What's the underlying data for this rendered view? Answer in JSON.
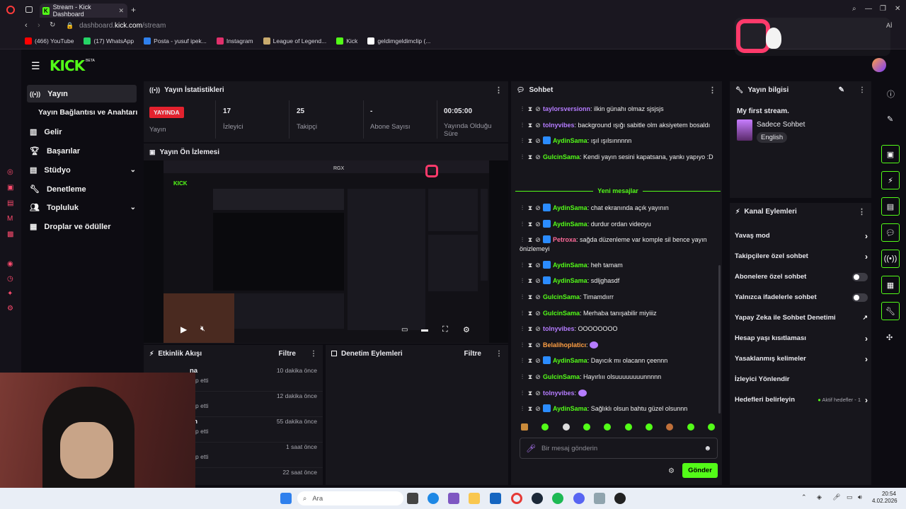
{
  "browser": {
    "tab_title": "Stream - Kick Dashboard",
    "url_prefix": "dashboard.",
    "url_domain": "kick.com",
    "url_path": "/stream",
    "bookmarks": [
      {
        "label": "(466) YouTube",
        "icon": "youtube-icon",
        "color": "#ff0000"
      },
      {
        "label": "(17) WhatsApp",
        "icon": "whatsapp-icon",
        "color": "#25d366"
      },
      {
        "label": "Posta - yusuf ipek...",
        "icon": "mail-icon",
        "color": "#2f80ed"
      },
      {
        "label": "Instagram",
        "icon": "instagram-icon",
        "color": "#e1306c"
      },
      {
        "label": "League of Legend...",
        "icon": "lol-icon",
        "color": "#c8aa6e"
      },
      {
        "label": "Kick",
        "icon": "kick-icon",
        "color": "#53fc18"
      },
      {
        "label": "geldimgeldimclip (...",
        "icon": "tiktok-icon",
        "color": "#ffffff"
      }
    ]
  },
  "app": {
    "logo": "KICK",
    "logo_beta": "BETA",
    "accent": "#53fc18"
  },
  "sidebar": {
    "items": [
      {
        "label": "Yayın",
        "icon": "stream-icon"
      },
      {
        "label": "Yayın Bağlantısı ve Anahtarı",
        "icon": ""
      },
      {
        "label": "Gelir",
        "icon": "chart-icon"
      },
      {
        "label": "Başarılar",
        "icon": "trophy-icon"
      },
      {
        "label": "Stüdyo",
        "icon": "studio-icon"
      },
      {
        "label": "Denetleme",
        "icon": "wrench-icon"
      },
      {
        "label": "Topluluk",
        "icon": "users-icon"
      },
      {
        "label": "Droplar ve ödüller",
        "icon": "gift-icon"
      }
    ]
  },
  "stats": {
    "title": "Yayın İstatistikleri",
    "live_badge": "YAYINDA",
    "live_label": "Yayın",
    "items": [
      {
        "value": "17",
        "label": "İzleyici"
      },
      {
        "value": "25",
        "label": "Takipçi"
      },
      {
        "value": "-",
        "label": "Abone Sayısı"
      },
      {
        "value": "00:05:00",
        "label": "Yayında Olduğu Süre"
      }
    ]
  },
  "preview": {
    "title": "Yayın Ön İzlemesi",
    "mini_badge": "RGX"
  },
  "activity": {
    "title": "Etkinlik Akışı",
    "filter": "Filtre",
    "rows": [
      {
        "name": "na",
        "action": "p etti",
        "time": "10 dakika önce"
      },
      {
        "name": "",
        "action": "p etti",
        "time": "12 dakika önce"
      },
      {
        "name": "an",
        "action": "p etti",
        "time": "55 dakika önce"
      },
      {
        "name": "",
        "action": "p etti",
        "time": "1 saat önce"
      },
      {
        "name": "",
        "action": "",
        "time": "22 saat önce"
      }
    ]
  },
  "moderation": {
    "title": "Denetim Eylemleri",
    "filter": "Filtre"
  },
  "chat": {
    "title": "Sohbet",
    "new_messages": "Yeni mesajlar",
    "placeholder": "Bir mesaj gönderin",
    "send": "Gönder",
    "messages_top": [
      {
        "user": "taylorsversionn",
        "color": "purple",
        "text": "ilkin günahı olmaz sjsjsjs",
        "badge": false
      },
      {
        "user": "tolnyvibes",
        "color": "purple",
        "text": "background ışığı sabitle olm aksiyetem bosaldı",
        "badge": false
      },
      {
        "user": "AydinSama",
        "color": "green",
        "text": "ışıl ışılsınnnnn",
        "badge": true
      },
      {
        "user": "GulcinSama",
        "color": "green",
        "text": "Kendi yayın sesini kapatsana, yankı yapıyo :D",
        "badge": false
      }
    ],
    "messages_bottom": [
      {
        "user": "AydinSama",
        "color": "green",
        "text": "chat ekranında açık yayının",
        "badge": true
      },
      {
        "user": "AydinSama",
        "color": "green",
        "text": "durdur ordan videoyu",
        "badge": true
      },
      {
        "user": "Petroxa",
        "color": "pink",
        "text": "sağda düzenleme var komple sil bence yayın önizlemeyi",
        "badge": true
      },
      {
        "user": "AydinSama",
        "color": "green",
        "text": "heh tamam",
        "badge": true
      },
      {
        "user": "AydinSama",
        "color": "green",
        "text": "sdljghasdf",
        "badge": true
      },
      {
        "user": "GulcinSama",
        "color": "green",
        "text": "Timamdıırr",
        "badge": false
      },
      {
        "user": "GulcinSama",
        "color": "green",
        "text": "Merhaba tanışabilir miyiiiz",
        "badge": false
      },
      {
        "user": "tolnyvibes",
        "color": "purple",
        "text": "OOOOOOOO",
        "badge": false
      },
      {
        "user": "Belalihoplaticı",
        "color": "orange",
        "text": "",
        "badge": false
      },
      {
        "user": "AydinSama",
        "color": "green",
        "text": "Dayıcık mı olacann çeennn",
        "badge": true
      },
      {
        "user": "GulcinSama",
        "color": "green",
        "text": "Hayırlııı olsuuuuuuuunnnnn",
        "badge": false
      },
      {
        "user": "tolnyvibes",
        "color": "purple",
        "text": "",
        "badge": false
      },
      {
        "user": "AydinSama",
        "color": "green",
        "text": "Sağlıklı olsun bahtu güzel olsunnn",
        "badge": true
      }
    ]
  },
  "stream_info": {
    "title": "Yayın bilgisi",
    "stream_title": "My first stream.",
    "category": "Sadece Sohbet",
    "language": "English"
  },
  "channel_actions": {
    "title": "Kanal Eylemleri",
    "items": [
      {
        "label": "Yavaş mod",
        "control": "chevron"
      },
      {
        "label": "Takipçilere özel sohbet",
        "control": "chevron"
      },
      {
        "label": "Abonelere özel sohbet",
        "control": "toggle"
      },
      {
        "label": "Yalnızca ifadelerle sohbet",
        "control": "toggle"
      },
      {
        "label": "Yapay Zeka ile Sohbet Denetimi",
        "control": "external"
      },
      {
        "label": "Hesap yaşı kısıtlaması",
        "control": "chevron"
      },
      {
        "label": "Yasaklanmış kelimeler",
        "control": "chevron"
      },
      {
        "label": "İzleyici Yönlendir",
        "control": "none"
      },
      {
        "label": "Hedefleri belirleyin",
        "control": "chevron"
      }
    ],
    "goals_badge": "Aktif hedefler - 1"
  },
  "taskbar": {
    "search": "Ara",
    "time": "20:54",
    "date": "4.02.2026"
  }
}
